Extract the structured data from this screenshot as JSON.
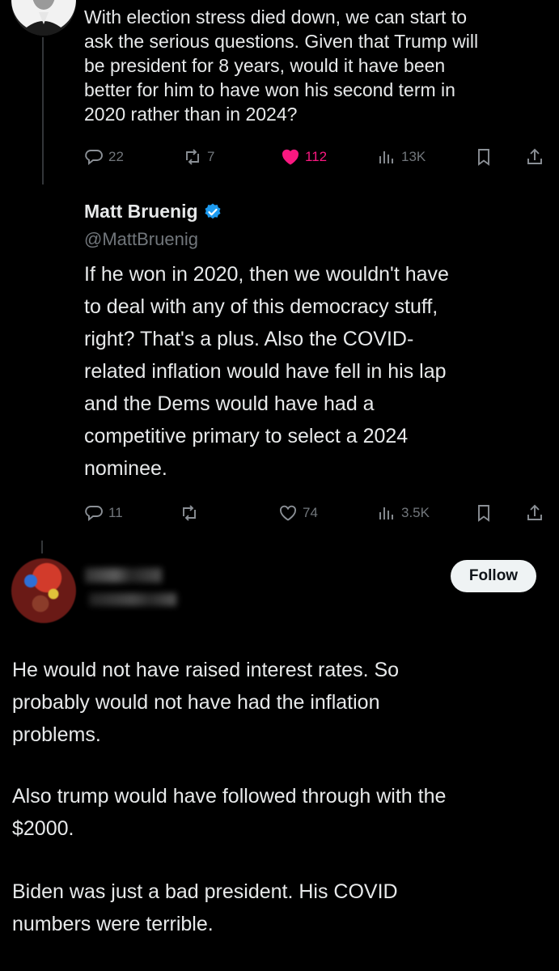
{
  "top_tweet": {
    "text": "With election stress died down, we can start to\nask the serious questions. Given that Trump will\nbe president for 8 years, would it have been\nbetter for him to have won his second term in\n2020 rather than in 2024?",
    "replies": "22",
    "reposts": "7",
    "likes": "112",
    "views": "13K",
    "liked": true,
    "like_color": "#f91880"
  },
  "reply_tweet": {
    "author_name": "Matt Bruenig",
    "handle": "@MattBruenig",
    "verified": true,
    "verified_color": "#1d9bf0",
    "text": "If he won in 2020, then we wouldn't have\nto deal with any of this democracy stuff,\nright? That's a plus. Also the COVID-\nrelated inflation would have fell in his lap\nand the Dems would have had a\ncompetitive primary to select a 2024\nnominee.",
    "replies": "11",
    "likes": "74",
    "views": "3.5K"
  },
  "third_post": {
    "follow_label": "Follow",
    "paragraphs": [
      "He would not have raised interest rates.  So\nprobably would not have had the inflation\nproblems.",
      "Also trump would have followed through with the\n$2000.",
      "Biden was just a bad president. His COVID\nnumbers were terrible."
    ]
  },
  "icons": {
    "reply": "reply-icon",
    "repost": "repost-icon",
    "like": "heart-icon",
    "views": "views-icon",
    "bookmark": "bookmark-icon",
    "share": "share-icon",
    "verified": "verified-badge-icon"
  }
}
